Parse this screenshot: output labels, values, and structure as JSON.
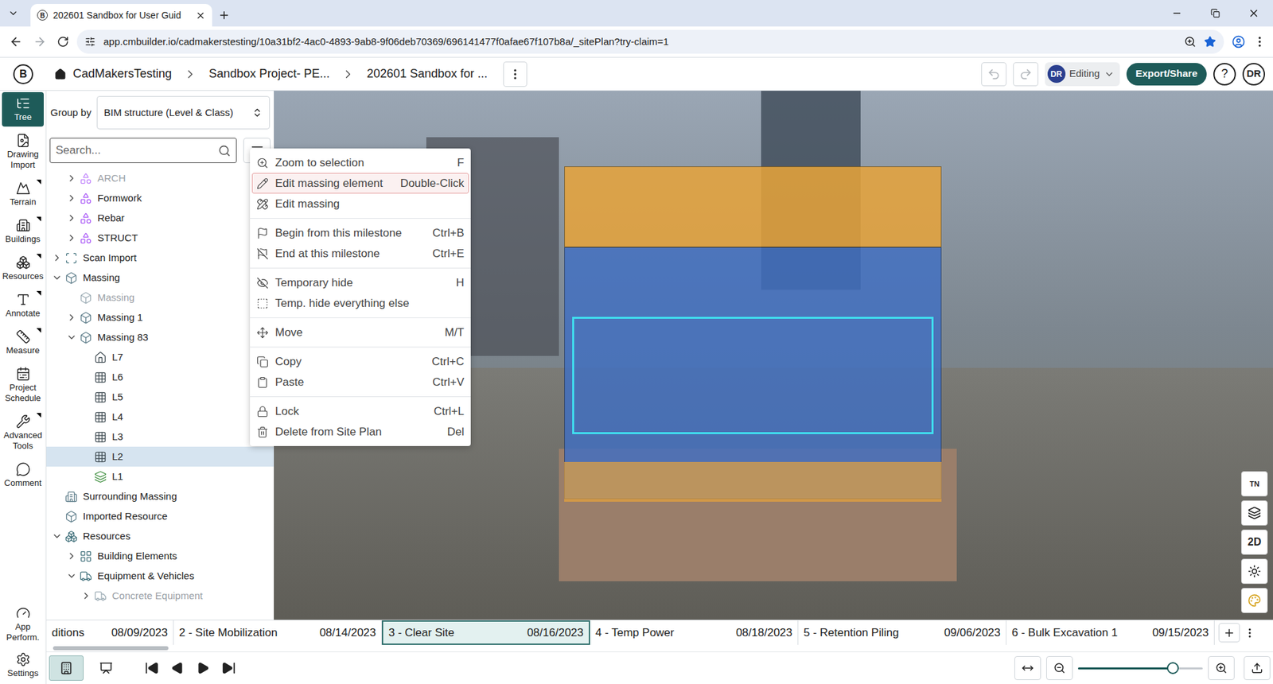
{
  "browser": {
    "favicon": "B",
    "tab_title": "202601 Sandbox for User Guid",
    "url": "app.cmbuilder.io/cadmakerstesting/10a31bf2-4ac0-4893-9ab8-9f06deb70369/696141477f0afae67f107b8a/_sitePlan?try-claim=1"
  },
  "header": {
    "logo": "B",
    "breadcrumbs": [
      "CadMakersTesting",
      "Sandbox Project- PE...",
      "202601 Sandbox for ..."
    ],
    "user_initials": "DR",
    "mode": "Editing",
    "export_button": "Export/Share",
    "help": "?",
    "avatar": "DR"
  },
  "rail": {
    "items": [
      {
        "label": "Tree",
        "selected": true,
        "submenu": false
      },
      {
        "label": "Drawing Import",
        "selected": false,
        "submenu": false
      },
      {
        "label": "Terrain",
        "selected": false,
        "submenu": true
      },
      {
        "label": "Buildings",
        "selected": false,
        "submenu": true
      },
      {
        "label": "Resources",
        "selected": false,
        "submenu": true
      },
      {
        "label": "Annotate",
        "selected": false,
        "submenu": true
      },
      {
        "label": "Measure",
        "selected": false,
        "submenu": true
      },
      {
        "label": "Project Schedule",
        "selected": false,
        "submenu": false
      },
      {
        "label": "Advanced Tools",
        "selected": false,
        "submenu": true
      },
      {
        "label": "Comment",
        "selected": false,
        "submenu": false
      }
    ],
    "bottom_items": [
      {
        "label": "App Perform.",
        "selected": false,
        "submenu": false
      },
      {
        "label": "Settings",
        "selected": false,
        "submenu": false
      }
    ]
  },
  "tree_panel": {
    "group_by_label": "Group by",
    "group_by_value": "BIM structure (Level & Class)",
    "search_placeholder": "Search...",
    "items": [
      {
        "label": "ARCH",
        "depth": 1,
        "has_children": true,
        "expanded": false,
        "dimmed": true,
        "selected": false
      },
      {
        "label": "Formwork",
        "depth": 1,
        "has_children": true,
        "expanded": false,
        "dimmed": false,
        "selected": false
      },
      {
        "label": "Rebar",
        "depth": 1,
        "has_children": true,
        "expanded": false,
        "dimmed": false,
        "selected": false
      },
      {
        "label": "STRUCT",
        "depth": 1,
        "has_children": true,
        "expanded": false,
        "dimmed": false,
        "selected": false
      },
      {
        "label": "Scan Import",
        "depth": 0,
        "has_children": true,
        "expanded": false,
        "dimmed": false,
        "selected": false
      },
      {
        "label": "Massing",
        "depth": 0,
        "has_children": true,
        "expanded": true,
        "dimmed": false,
        "selected": false
      },
      {
        "label": "Massing",
        "depth": 1,
        "has_children": false,
        "expanded": false,
        "dimmed": true,
        "selected": false
      },
      {
        "label": "Massing 1",
        "depth": 1,
        "has_children": true,
        "expanded": false,
        "dimmed": false,
        "selected": false
      },
      {
        "label": "Massing 83",
        "depth": 1,
        "has_children": true,
        "expanded": true,
        "dimmed": false,
        "selected": false
      },
      {
        "label": "L7",
        "depth": 2,
        "has_children": false,
        "expanded": false,
        "dimmed": false,
        "selected": false
      },
      {
        "label": "L6",
        "depth": 2,
        "has_children": false,
        "expanded": false,
        "dimmed": false,
        "selected": false
      },
      {
        "label": "L5",
        "depth": 2,
        "has_children": false,
        "expanded": false,
        "dimmed": false,
        "selected": false
      },
      {
        "label": "L4",
        "depth": 2,
        "has_children": false,
        "expanded": false,
        "dimmed": false,
        "selected": false
      },
      {
        "label": "L3",
        "depth": 2,
        "has_children": false,
        "expanded": false,
        "dimmed": false,
        "selected": false
      },
      {
        "label": "L2",
        "depth": 2,
        "has_children": false,
        "expanded": false,
        "dimmed": false,
        "selected": true
      },
      {
        "label": "L1",
        "depth": 2,
        "has_children": false,
        "expanded": false,
        "dimmed": false,
        "selected": false
      },
      {
        "label": "Surrounding Massing",
        "depth": 0,
        "has_children": false,
        "expanded": false,
        "dimmed": false,
        "selected": false
      },
      {
        "label": "Imported Resource",
        "depth": 0,
        "has_children": false,
        "expanded": false,
        "dimmed": false,
        "selected": false
      },
      {
        "label": "Resources",
        "depth": 0,
        "has_children": true,
        "expanded": true,
        "dimmed": false,
        "selected": false
      },
      {
        "label": "Building Elements",
        "depth": 1,
        "has_children": true,
        "expanded": false,
        "dimmed": false,
        "selected": false
      },
      {
        "label": "Equipment & Vehicles",
        "depth": 1,
        "has_children": true,
        "expanded": true,
        "dimmed": false,
        "selected": false
      },
      {
        "label": "Concrete Equipment",
        "depth": 2,
        "has_children": true,
        "expanded": false,
        "dimmed": true,
        "selected": false
      }
    ]
  },
  "context_menu": {
    "groups": [
      [
        {
          "label": "Zoom to selection",
          "shortcut": "F",
          "highlighted": false
        },
        {
          "label": "Edit massing element",
          "shortcut": "Double-Click",
          "highlighted": true
        },
        {
          "label": "Edit massing",
          "highlighted": false
        }
      ],
      [
        {
          "label": "Begin from this milestone",
          "shortcut": "Ctrl+B",
          "highlighted": false
        },
        {
          "label": "End at this milestone",
          "shortcut": "Ctrl+E",
          "highlighted": false
        }
      ],
      [
        {
          "label": "Temporary hide",
          "shortcut": "H",
          "highlighted": false
        },
        {
          "label": "Temp. hide everything else",
          "highlighted": false
        }
      ],
      [
        {
          "label": "Move",
          "shortcut": "M/T",
          "highlighted": false
        }
      ],
      [
        {
          "label": "Copy",
          "shortcut": "Ctrl+C",
          "highlighted": false
        },
        {
          "label": "Paste",
          "shortcut": "Ctrl+V",
          "highlighted": false
        }
      ],
      [
        {
          "label": "Lock",
          "shortcut": "Ctrl+L",
          "highlighted": false
        },
        {
          "label": "Delete from Site Plan",
          "shortcut": "Del",
          "highlighted": false
        }
      ]
    ]
  },
  "viewport_tools": {
    "north": "TN",
    "view_2d": "2D"
  },
  "timeline": {
    "milestones": [
      {
        "name": "ditions",
        "date": "08/09/2023",
        "selected": false
      },
      {
        "name": "2 - Site Mobilization",
        "date": "08/14/2023",
        "selected": false
      },
      {
        "name": "3 - Clear Site",
        "date": "08/16/2023",
        "selected": true
      },
      {
        "name": "4 - Temp Power",
        "date": "08/18/2023",
        "selected": false
      },
      {
        "name": "5 - Retention Piling",
        "date": "09/06/2023",
        "selected": false
      },
      {
        "name": "6 - Bulk Excavation 1",
        "date": "09/15/2023",
        "selected": false
      }
    ],
    "scroll": {
      "level": 0.095
    }
  },
  "bottom_toolbar": {
    "view_modes": [
      {
        "selected": true
      },
      {
        "selected": false
      }
    ],
    "zoom": {
      "level": 0.76
    }
  }
}
